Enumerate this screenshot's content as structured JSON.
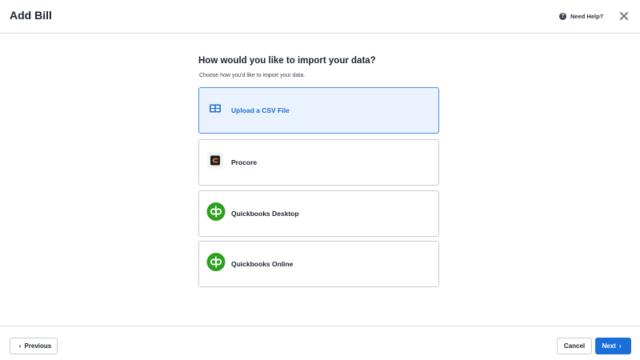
{
  "header": {
    "title": "Add Bill",
    "help_label": "Need Help?",
    "help_icon": "question-circle-icon",
    "close_icon": "close-icon"
  },
  "main": {
    "heading": "How would you like to import your data?",
    "subheading": "Choose how you'd like to import your data.",
    "options": [
      {
        "label": "Upload a CSV File",
        "icon": "table-icon",
        "selected": true
      },
      {
        "label": "Procore",
        "icon": "procore-logo-icon",
        "selected": false
      },
      {
        "label": "Quickbooks Desktop",
        "icon": "quickbooks-logo-icon",
        "selected": false
      },
      {
        "label": "Quickbooks Online",
        "icon": "quickbooks-logo-icon",
        "selected": false
      }
    ]
  },
  "footer": {
    "previous_label": "Previous",
    "cancel_label": "Cancel",
    "next_label": "Next"
  },
  "colors": {
    "accent": "#1a6fd8",
    "selected_bg": "#eaf2fd",
    "quickbooks_green": "#2ca01c",
    "procore_orange": "#f47e42"
  }
}
